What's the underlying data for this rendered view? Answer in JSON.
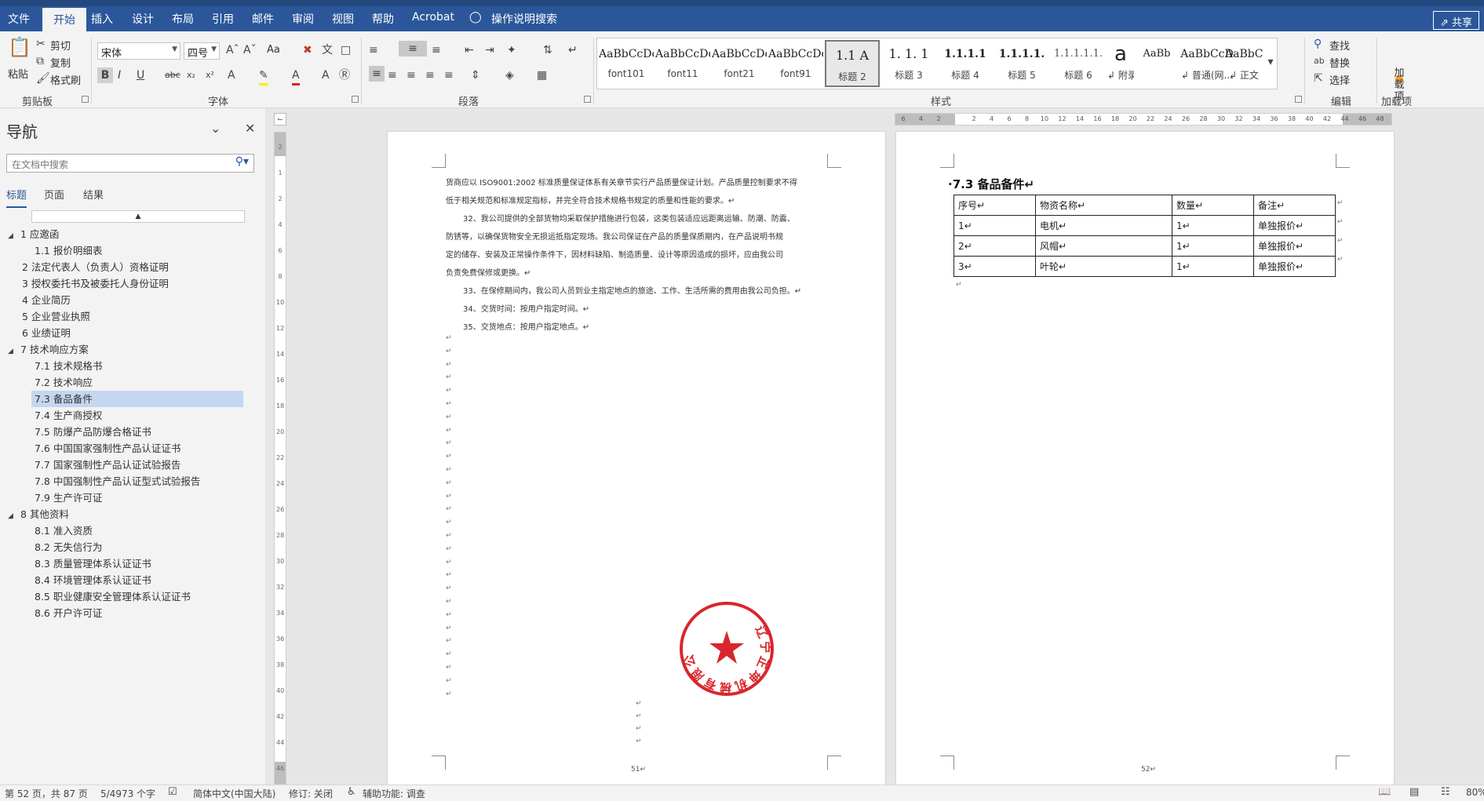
{
  "menu": {
    "file": "文件",
    "home": "开始",
    "insert": "插入",
    "design": "设计",
    "layout": "布局",
    "references": "引用",
    "mailings": "邮件",
    "review": "审阅",
    "view": "视图",
    "help": "帮助",
    "acrobat": "Acrobat",
    "tell_me": "操作说明搜索",
    "share": "共享"
  },
  "ribbon": {
    "clipboard": {
      "paste": "粘贴",
      "cut": "剪切",
      "copy": "复制",
      "format_painter": "格式刷",
      "label": "剪贴板"
    },
    "font": {
      "name": "宋体",
      "size": "四号",
      "aa": "Aa",
      "label": "字体"
    },
    "paragraph": {
      "label": "段落"
    },
    "styles": {
      "label": "样式",
      "items": [
        {
          "sample": "AaBbCcDc",
          "name": "font101"
        },
        {
          "sample": "AaBbCcDdI",
          "name": "font11"
        },
        {
          "sample": "AaBbCcDc",
          "name": "font21"
        },
        {
          "sample": "AaBbCcDc",
          "name": "font91"
        },
        {
          "sample": "1.1  A",
          "name": "标题 2"
        },
        {
          "sample": "1. 1. 1",
          "name": "标题 3"
        },
        {
          "sample": "1.1.1.1",
          "name": "标题 4"
        },
        {
          "sample": "1.1.1.1.",
          "name": "标题 5"
        },
        {
          "sample": "1.1.1.1.1.",
          "name": "标题 6"
        },
        {
          "sample": "a",
          "name": "↲ 附录三..."
        },
        {
          "sample": "AaBb",
          "name": "↲ 普通(网..."
        },
        {
          "sample": "AaBbCcD",
          "name": "↲ 正文"
        }
      ],
      "extra_sample": "AaBbCcD"
    },
    "editing": {
      "find": "查找",
      "replace": "替换",
      "select": "选择",
      "label": "编辑"
    },
    "addins": {
      "btn": "加载项",
      "label": "加载项"
    }
  },
  "nav": {
    "title": "导航",
    "search_placeholder": "在文档中搜索",
    "tabs": [
      "标题",
      "页面",
      "结果"
    ],
    "items": [
      {
        "text": "1 应邀函"
      },
      {
        "text": "1.1 报价明细表"
      },
      {
        "text": "2 法定代表人（负责人）资格证明"
      },
      {
        "text": "3 授权委托书及被委托人身份证明"
      },
      {
        "text": "4 企业简历"
      },
      {
        "text": "5 企业营业执照"
      },
      {
        "text": "6 业绩证明"
      },
      {
        "text": "7 技术响应方案"
      },
      {
        "text": "7.1 技术规格书"
      },
      {
        "text": "7.2 技术响应"
      },
      {
        "text": "7.3 备品备件"
      },
      {
        "text": "7.4 生产商授权"
      },
      {
        "text": "7.5 防爆产品防爆合格证书"
      },
      {
        "text": "7.6 中国国家强制性产品认证证书"
      },
      {
        "text": "7.7 国家强制性产品认证试验报告"
      },
      {
        "text": "7.8 中国强制性产品认证型式试验报告"
      },
      {
        "text": "7.9 生产许可证"
      },
      {
        "text": "8 其他资料"
      },
      {
        "text": "8.1 准入资质"
      },
      {
        "text": "8.2 无失信行为"
      },
      {
        "text": "8.3 质量管理体系认证证书"
      },
      {
        "text": "8.4 环境管理体系认证证书"
      },
      {
        "text": "8.5 职业健康安全管理体系认证证书"
      },
      {
        "text": "8.6 开户许可证"
      }
    ]
  },
  "ruler": {
    "v_ticks": [
      "2",
      "1",
      "2",
      "4",
      "6",
      "8",
      "10",
      "12",
      "14",
      "16",
      "18",
      "20",
      "22",
      "24",
      "26",
      "28",
      "30",
      "32",
      "34",
      "36",
      "38",
      "40",
      "42",
      "44",
      "46"
    ],
    "h_ticks": [
      "6",
      "4",
      "2",
      "",
      "2",
      "4",
      "6",
      "8",
      "10",
      "12",
      "14",
      "16",
      "18",
      "20",
      "22",
      "24",
      "26",
      "28",
      "30",
      "32",
      "34",
      "36",
      "38",
      "40",
      "42",
      "44",
      "46",
      "48"
    ]
  },
  "page51": {
    "lines": [
      "货商应以 ISO9001:2002 标准质量保证体系有关章节实行产品质量保证计划。产品质量控制要求不得",
      "低于相关规范和标准规定指标，并完全符合技术规格书规定的质量和性能的要求。↵",
      "32、我公司提供的全部货物均采取保护措施进行包装，这类包装适应远距离运输、防潮、防震、",
      "防锈等，以确保货物安全无损运抵指定现场。我公司保证在产品的质量保质期内，在产品说明书规",
      "定的储存、安装及正常操作条件下，因材料缺陷、制造质量、设计等原因造成的损坏，应由我公司",
      "负责免费保修或更换。↵",
      "33、在保修期间内，我公司人员到业主指定地点的旅途、工作、生活所需的费用由我公司负担。↵",
      "34、交货时间：按用户指定时间。↵",
      "35、交货地点：按用户指定地点。↵"
    ],
    "page_number": "51↵"
  },
  "page52": {
    "heading": "·7.3  备品备件↵",
    "table": {
      "headers": [
        "序号↵",
        "物资名称↵",
        "数量↵",
        "备注↵"
      ],
      "rows": [
        [
          "1↵",
          "电机↵",
          "1↵",
          "单独报价↵"
        ],
        [
          "2↵",
          "风帽↵",
          "1↵",
          "单独报价↵"
        ],
        [
          "3↵",
          "叶轮↵",
          "1↵",
          "单独报价↵"
        ]
      ]
    },
    "page_number": "52↵"
  },
  "stamp": {
    "text": "辽宁正坤机械有限公司"
  },
  "status": {
    "page": "第 52 页，共 87 页",
    "words": "5/4973 个字",
    "language": "简体中文(中国大陆)",
    "track": "修订: 关闭",
    "accessibility": "辅助功能: 调查",
    "zoom": "80%"
  },
  "colors": {
    "accent": "#2b579a",
    "stamp": "#d9262c",
    "nav_selected": "#c5d7f0"
  }
}
